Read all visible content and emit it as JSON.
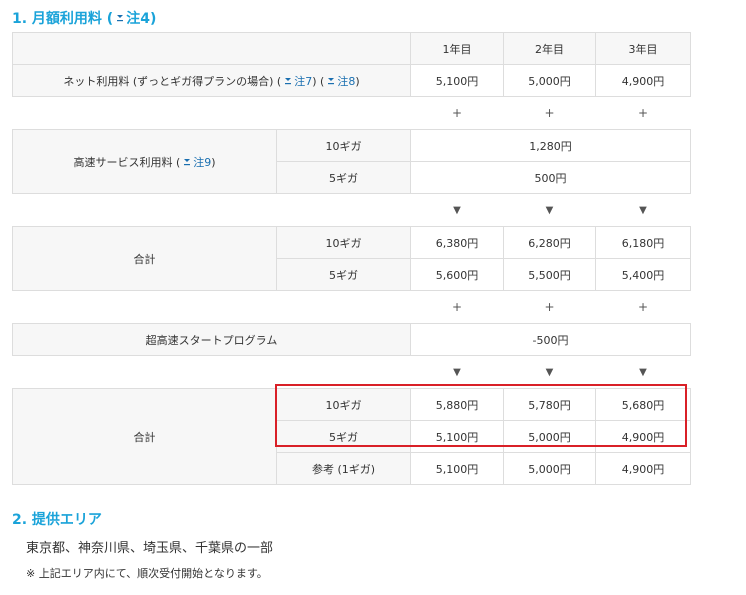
{
  "section1": {
    "title": "1. 月額利用料 (",
    "note": "注4",
    "close": ")"
  },
  "table": {
    "years": [
      "1年目",
      "2年目",
      "3年目"
    ],
    "net": {
      "label": "ネット利用料 (ずっとギガ得プランの場合) (",
      "note1": "注7",
      "mid": ") (",
      "note2": "注8",
      "end": ")",
      "values": [
        "5,100円",
        "5,000円",
        "4,900円"
      ]
    },
    "plus": "+",
    "speed": {
      "label": "高速サービス利用料 (",
      "note": "注9",
      "end": ")",
      "rows": [
        {
          "tier": "10ギガ",
          "value": "1,280円"
        },
        {
          "tier": "5ギガ",
          "value": "500円"
        }
      ]
    },
    "arrow": "▼",
    "total1": {
      "label": "合計",
      "rows": [
        {
          "tier": "10ギガ",
          "values": [
            "6,380円",
            "6,280円",
            "6,180円"
          ]
        },
        {
          "tier": "5ギガ",
          "values": [
            "5,600円",
            "5,500円",
            "5,400円"
          ]
        }
      ]
    },
    "start_program": {
      "label": "超高速スタートプログラム",
      "value": "-500円"
    },
    "total2": {
      "label": "合計",
      "rows": [
        {
          "tier": "10ギガ",
          "values": [
            "5,880円",
            "5,780円",
            "5,680円"
          ]
        },
        {
          "tier": "5ギガ",
          "values": [
            "5,100円",
            "5,000円",
            "4,900円"
          ]
        },
        {
          "tier": "参考 (1ギガ)",
          "values": [
            "5,100円",
            "5,000円",
            "4,900円"
          ]
        }
      ]
    }
  },
  "section2": {
    "title": "2. 提供エリア",
    "text": "東京都、神奈川県、埼玉県、千葉県の一部",
    "note": "※ 上記エリア内にて、順次受付開始となります。"
  },
  "colors": {
    "accent": "#1aa3d9",
    "highlight": "#d92027",
    "link": "#1a6fb0"
  }
}
